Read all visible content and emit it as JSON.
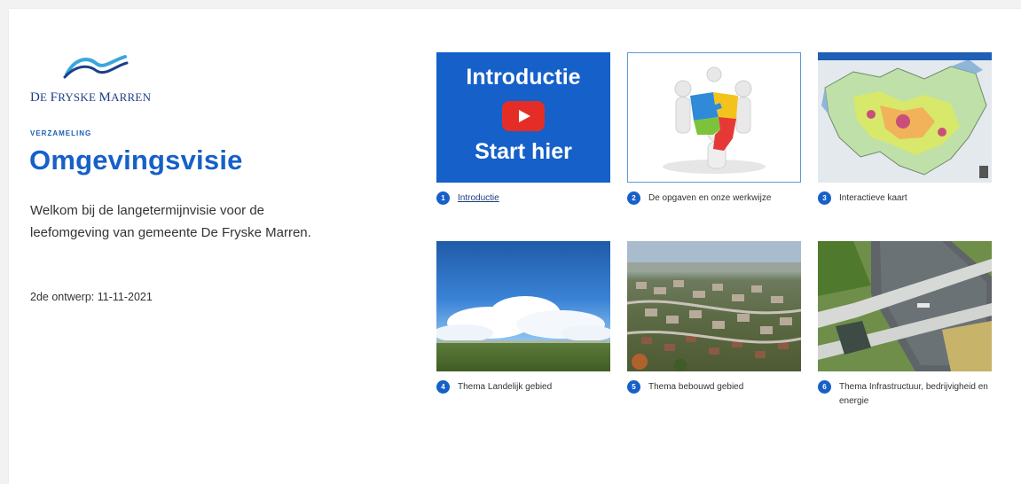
{
  "brand": {
    "logo_name": "De Fryske Marren",
    "logo_text_prefix_big": "D",
    "logo_text_1": "E ",
    "logo_text_big_2": "F",
    "logo_text_2": "RYSKE ",
    "logo_text_big_3": "M",
    "logo_text_3": "ARREN",
    "logo_colors": [
      "#1b3f8a",
      "#3aa6dc"
    ]
  },
  "header": {
    "collection_label": "VERZAMELING",
    "title": "Omgevingsvisie",
    "intro": "Welkom bij de langetermijnvisie voor de leefomgeving van gemeente De Fryske Marren.",
    "draft_date": "2de ontwerp: 11-11-2021"
  },
  "tiles": [
    {
      "number": "1",
      "label": "Introductie",
      "thumb_line1": "Introductie",
      "thumb_line2": "Start hier",
      "icon": "play-button-icon"
    },
    {
      "number": "2",
      "label": "De opgaven en onze werkwijze",
      "icon": "puzzle-icon"
    },
    {
      "number": "3",
      "label": "Interactieve kaart",
      "icon": "map-icon"
    },
    {
      "number": "4",
      "label": "Thema Landelijk gebied"
    },
    {
      "number": "5",
      "label": "Thema bebouwd gebied"
    },
    {
      "number": "6",
      "label": "Thema Infrastructuur, bedrijvigheid en energie"
    }
  ],
  "colors": {
    "accent": "#1660c8",
    "text": "#333333",
    "background": "#ffffff"
  }
}
